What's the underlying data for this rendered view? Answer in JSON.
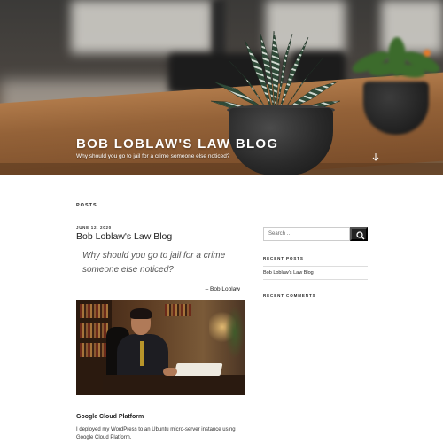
{
  "header": {
    "site_title": "Bob Loblaw's Law Blog",
    "site_description": "Why should you go to jail for a crime someone else noticed?",
    "scroll_icon": "arrow-down-icon"
  },
  "main": {
    "section_heading": "POSTS",
    "post": {
      "date": "JUNE 12, 2020",
      "title": "Bob Loblaw's Law Blog",
      "quote": "Why should you go to jail for a crime someone else noticed?",
      "quote_cite": "– Bob Loblaw",
      "subheading": "Google Cloud Platform",
      "body": "I deployed my WordPress to an Ubuntu micro-server instance using Google Cloud Platform."
    }
  },
  "sidebar": {
    "search": {
      "placeholder": "Search …",
      "button_icon": "search-icon"
    },
    "recent_posts_heading": "RECENT POSTS",
    "recent_posts": [
      "Bob Loblaw's Law Blog"
    ],
    "recent_comments_heading": "RECENT COMMENTS"
  },
  "colors": {
    "header_text": "#ffffff",
    "button_bg": "#222222",
    "text": "#222222"
  }
}
